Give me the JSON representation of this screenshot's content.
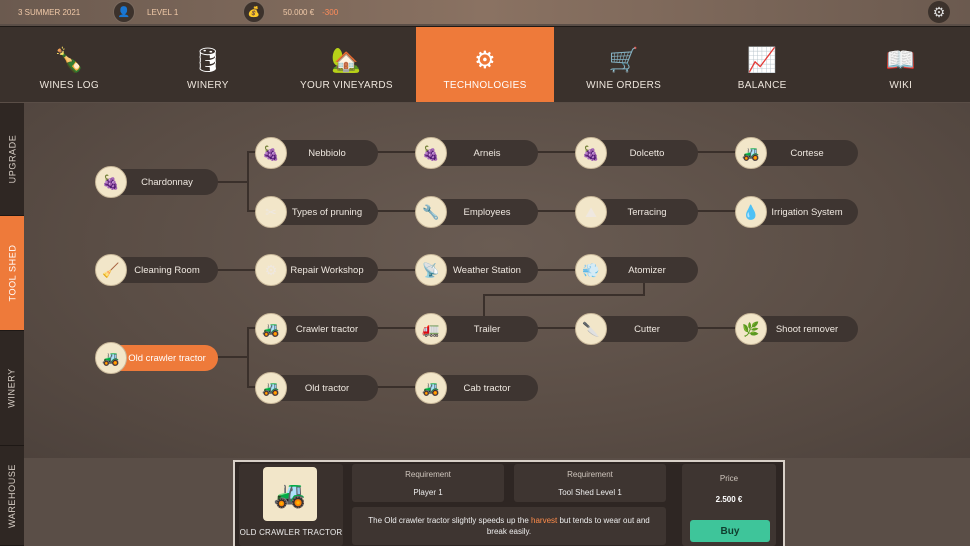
{
  "status": {
    "season": "3 SUMMER 2021",
    "level": "LEVEL 1",
    "money": "50.000 €",
    "money_change": "-300"
  },
  "nav": {
    "tabs": [
      {
        "label": "WINES LOG",
        "icon": "wine-bottles-icon",
        "glyph": "🍾"
      },
      {
        "label": "WINERY",
        "icon": "barrel-icon",
        "glyph": "🛢"
      },
      {
        "label": "YOUR VINEYARDS",
        "icon": "vineyard-icon",
        "glyph": "🏡"
      },
      {
        "label": "TECHNOLOGIES",
        "icon": "gears-icon",
        "glyph": "⚙"
      },
      {
        "label": "WINE ORDERS",
        "icon": "hand-truck-icon",
        "glyph": "🛒"
      },
      {
        "label": "BALANCE",
        "icon": "monitor-chart-icon",
        "glyph": "📈"
      },
      {
        "label": "WIKI",
        "icon": "book-icon",
        "glyph": "📖"
      }
    ],
    "active": "TECHNOLOGIES"
  },
  "side_tabs": [
    "UPGRADE",
    "TOOL SHED",
    "WINERY",
    "WAREHOUSE"
  ],
  "tree": {
    "nodes": {
      "chardonnay": {
        "label": "Chardonnay",
        "glyph": "🍇"
      },
      "nebbiolo": {
        "label": "Nebbiolo",
        "glyph": "🍇"
      },
      "arneis": {
        "label": "Arneis",
        "glyph": "🍇"
      },
      "dolcetto": {
        "label": "Dolcetto",
        "glyph": "🍇"
      },
      "cortese": {
        "label": "Cortese",
        "glyph": "🚜"
      },
      "pruning": {
        "label": "Types of pruning",
        "glyph": "✂"
      },
      "employees": {
        "label": "Employees",
        "glyph": "🔧"
      },
      "terracing": {
        "label": "Terracing",
        "glyph": "⛰"
      },
      "irrigation": {
        "label": "Irrigation System",
        "glyph": "💧"
      },
      "cleaning": {
        "label": "Cleaning Room",
        "glyph": "🧹"
      },
      "repair": {
        "label": "Repair Workshop",
        "glyph": "⚙"
      },
      "weather": {
        "label": "Weather Station",
        "glyph": "📡"
      },
      "atomizer": {
        "label": "Atomizer",
        "glyph": "💨"
      },
      "crawler": {
        "label": "Crawler tractor",
        "glyph": "🚜"
      },
      "trailer": {
        "label": "Trailer",
        "glyph": "🚛"
      },
      "cutter": {
        "label": "Cutter",
        "glyph": "🔪"
      },
      "shoot_remover": {
        "label": "Shoot remover",
        "glyph": "🌿"
      },
      "old_crawler": {
        "label": "Old crawler tractor",
        "glyph": "🚜"
      },
      "old_tractor": {
        "label": "Old tractor",
        "glyph": "🚜"
      },
      "cab_tractor": {
        "label": "Cab tractor",
        "glyph": "🚜"
      }
    }
  },
  "details": {
    "name": "OLD CRAWLER TRACTOR",
    "glyph": "🚜",
    "req1_title": "Requirement",
    "req1_value": "Player 1",
    "req2_title": "Requirement",
    "req2_value": "Tool Shed Level 1",
    "desc_before": "The Old crawler tractor slightly speeds up the ",
    "desc_highlight": "harvest",
    "desc_after": " but tends to wear out and break easily.",
    "price_title": "Price",
    "price_value": "2.500 €",
    "buy_label": "Buy"
  }
}
